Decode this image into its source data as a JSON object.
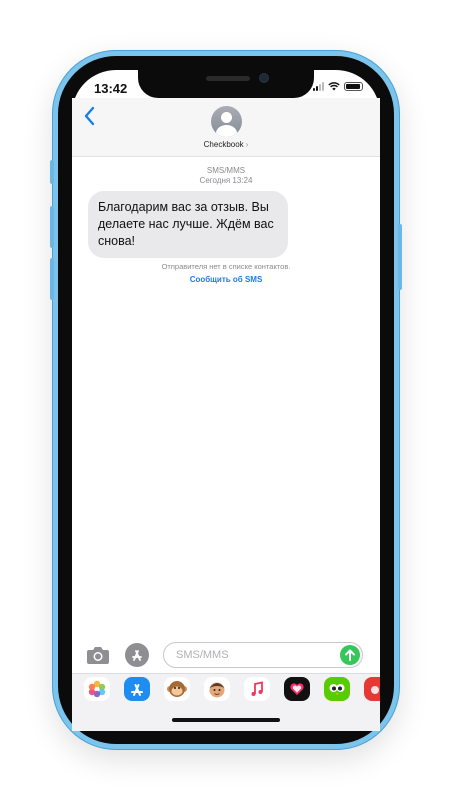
{
  "status_bar": {
    "time": "13:42"
  },
  "header": {
    "contact_name": "Checkbook",
    "chevron": "›"
  },
  "conversation": {
    "message_type": "SMS/MMS",
    "timestamp": "Сегодня 13:24",
    "messages": [
      {
        "sender": "Checkbook",
        "text": "Благодарим вас за отзыв. Вы делаете нас лучше. Ждём вас снова!"
      }
    ],
    "unknown_sender_notice": "Отправителя нет в списке контактов.",
    "report_link": "Сообщить об SMS"
  },
  "compose": {
    "placeholder": "SMS/MMS"
  },
  "app_strip": {
    "apps": [
      "photos-app-icon",
      "app-store-icon",
      "animoji-icon",
      "memoji-icon",
      "music-icon",
      "digital-touch-icon",
      "duolingo-icon",
      "red-app-icon"
    ]
  },
  "colors": {
    "frame": "#7cc4ec",
    "accent": "#1a7ee6",
    "send": "#35c759",
    "bubble": "#e9e9eb"
  }
}
